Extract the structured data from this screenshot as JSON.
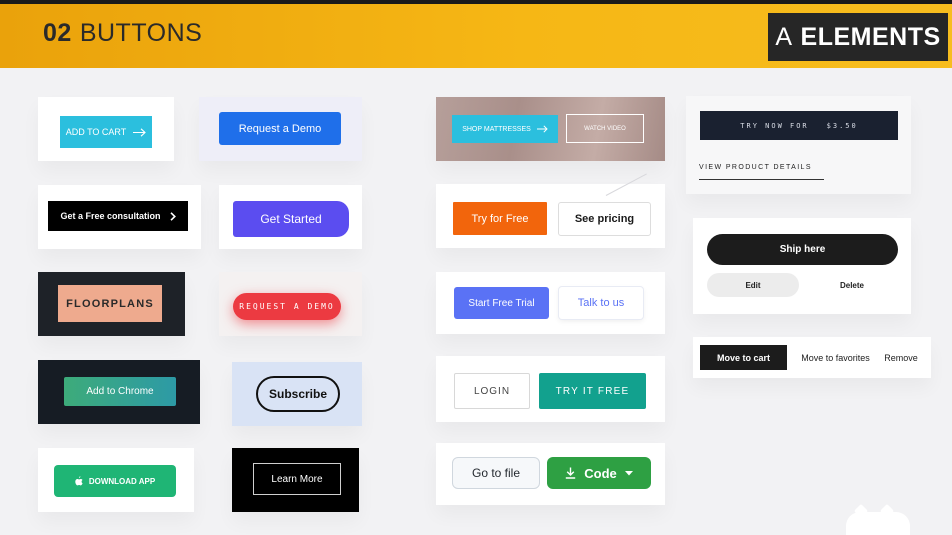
{
  "header": {
    "number": "02",
    "title": "BUTTONS",
    "badge_prefix": "A",
    "badge_label": "ELEMENTS",
    "accent_color": "#f6b715"
  },
  "buttons": {
    "add_to_cart": "ADD TO CART",
    "request_demo": "Request a Demo",
    "free_consultation": "Get a Free consultation",
    "get_started": "Get Started",
    "floorplans": "FLOORPLANS",
    "request_a_demo_pill": "REQUEST A DEMO",
    "add_to_chrome": "Add to Chrome",
    "subscribe": "Subscribe",
    "download_app": "DOWNLOAD APP",
    "learn_more": "Learn More",
    "shop_mattresses": "SHOP MATTRESSES",
    "watch_video": "WATCH VIDEO",
    "try_for_free": "Try for Free",
    "see_pricing": "See pricing",
    "start_free_trial": "Start Free Trial",
    "talk_to_us": "Talk to us",
    "login": "LOGIN",
    "try_it_free": "TRY IT FREE",
    "go_to_file": "Go to file",
    "code": "Code",
    "try_now_for": "TRY NOW FOR",
    "try_now_price": "$3.50",
    "view_product_details": "VIEW PRODUCT DETAILS",
    "ship_here": "Ship here",
    "edit": "Edit",
    "delete": "Delete",
    "move_to_cart": "Move to cart",
    "move_to_favorites": "Move to favorites",
    "remove": "Remove"
  },
  "icons": {
    "cart_arrow": "arrow-right-icon",
    "consult_chevron": "chevron-right-icon",
    "mattress_arrow": "arrow-right-icon",
    "download": "apple-icon",
    "code_download": "download-icon",
    "code_caret": "caret-down-icon"
  }
}
